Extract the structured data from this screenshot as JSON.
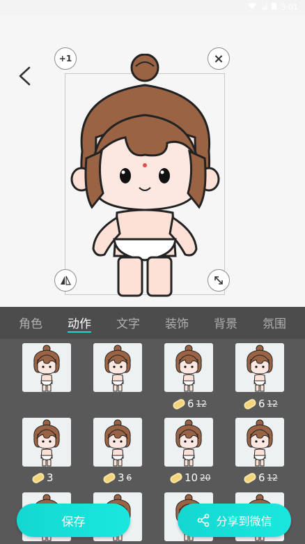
{
  "status_bar": {
    "time": "3:01"
  },
  "canvas": {
    "plus_one_label": "+1",
    "close_label": "×"
  },
  "tabs": [
    {
      "label": "角色",
      "active": false
    },
    {
      "label": "动作",
      "active": true
    },
    {
      "label": "文字",
      "active": false
    },
    {
      "label": "装饰",
      "active": false
    },
    {
      "label": "背景",
      "active": false
    },
    {
      "label": "氛围",
      "active": false
    }
  ],
  "actions": [
    {
      "price": "",
      "original_price": ""
    },
    {
      "price": "",
      "original_price": ""
    },
    {
      "price": "6",
      "original_price": "12"
    },
    {
      "price": "6",
      "original_price": "12"
    },
    {
      "price": "3",
      "original_price": ""
    },
    {
      "price": "3",
      "original_price": "6"
    },
    {
      "price": "10",
      "original_price": "20"
    },
    {
      "price": "6",
      "original_price": "12"
    }
  ],
  "buttons": {
    "save": "保存",
    "share": "分享到微信"
  },
  "colors": {
    "accent": "#1ad9d2",
    "tabbar_bg": "#4c4c4c",
    "grid_bg": "#595959"
  }
}
